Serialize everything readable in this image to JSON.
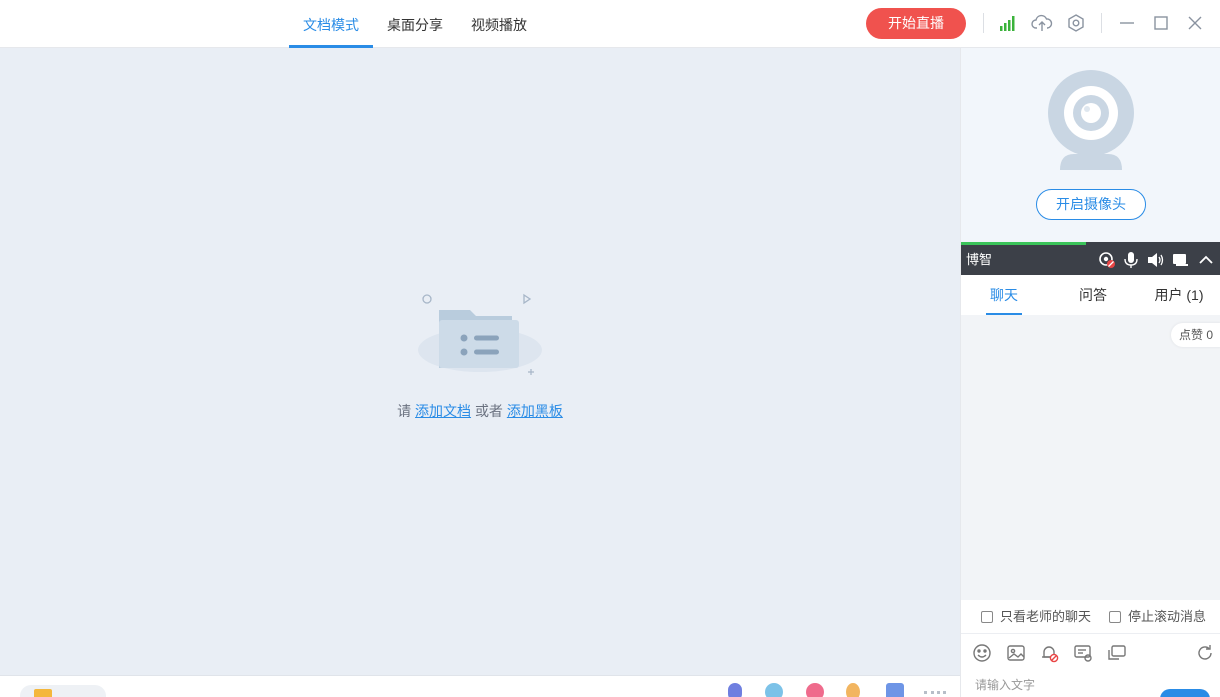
{
  "header": {
    "tabs": [
      {
        "label": "文档模式",
        "active": true
      },
      {
        "label": "桌面分享",
        "active": false
      },
      {
        "label": "视频播放",
        "active": false
      }
    ],
    "start_live_label": "开始直播",
    "icons": [
      "signal-icon",
      "cloud-upload-icon",
      "settings-icon",
      "minimize-icon",
      "maximize-icon",
      "close-icon"
    ]
  },
  "canvas": {
    "empty_prefix": "请",
    "add_doc_link": "添加文档",
    "or_text": "或者",
    "add_board_link": "添加黑板"
  },
  "right_panel": {
    "camera_button": "开启摄像头",
    "volume_level_fraction": 0.48,
    "user_name": "博智",
    "chat_tabs": [
      {
        "label": "聊天",
        "active": true
      },
      {
        "label": "问答",
        "active": false
      },
      {
        "label": "用户 (1)",
        "active": false
      }
    ],
    "likes_label": "点赞 0",
    "option_teacher_only": "只看老师的聊天",
    "option_stop_scroll": "停止滚动消息",
    "input_placeholder": "请输入文字"
  },
  "colors": {
    "accent": "#2a8ce6",
    "start_button": "#f0524e",
    "dark_bar": "#3c4048",
    "signal": "#3bb33b"
  }
}
